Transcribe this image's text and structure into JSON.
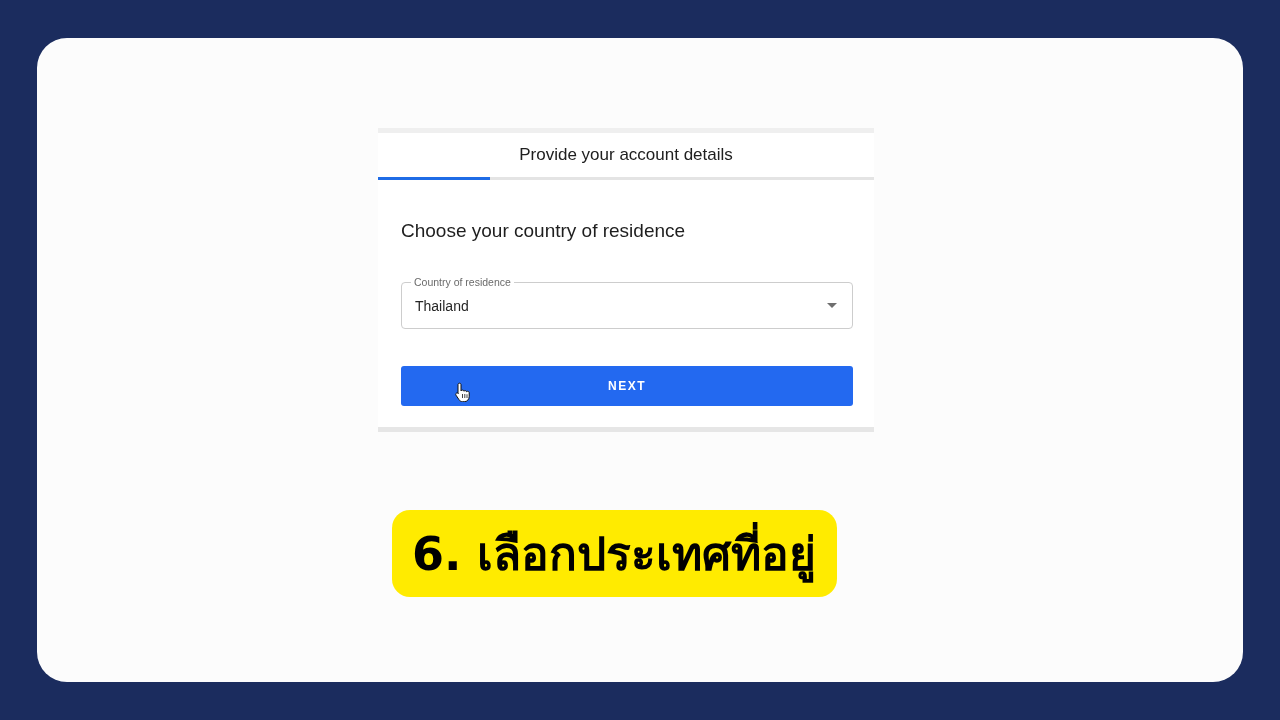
{
  "screenshot": {
    "header": {
      "title": "Provide your account details",
      "progress": {
        "level": 0.225
      }
    },
    "heading": "Choose your country of residence",
    "country_field": {
      "label": "Country of residence",
      "value": "Thailand"
    },
    "next_button": {
      "label": "NEXT"
    }
  },
  "caption": "6. เลือกประเทศที่อยู่"
}
